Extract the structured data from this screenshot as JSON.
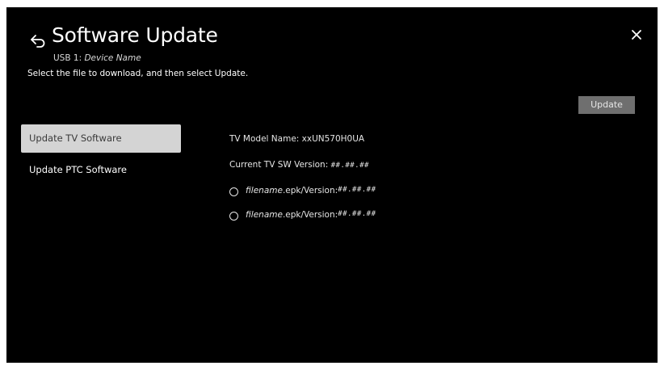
{
  "header": {
    "back_icon": "back-arrow-icon",
    "title": "Software Update",
    "subtitle_prefix": "USB 1: ",
    "device_name": "Device Name",
    "instruction": "Select the file to download, and then select Update.",
    "close_icon": "close-icon"
  },
  "actions": {
    "update_label": "Update"
  },
  "menu": {
    "items": [
      {
        "label": "Update TV Software",
        "selected": true
      },
      {
        "label": "Update PTC Software",
        "selected": false
      }
    ]
  },
  "info": {
    "model_label": "TV Model Name: ",
    "model_value": "xxUN570H0UA",
    "version_label": "Current TV SW Version: ",
    "version_value": "##.##.##",
    "files": [
      {
        "name": "filename",
        "suffix": ".epk/Version: ",
        "version": "##.##.##",
        "selected": false
      },
      {
        "name": "filename",
        "suffix": ".epk/Version: ",
        "version": "##.##.##",
        "selected": false
      }
    ]
  },
  "colors": {
    "background": "#000000",
    "selected_item_bg": "#d4d4d4",
    "button_bg": "#6f6f6f"
  }
}
